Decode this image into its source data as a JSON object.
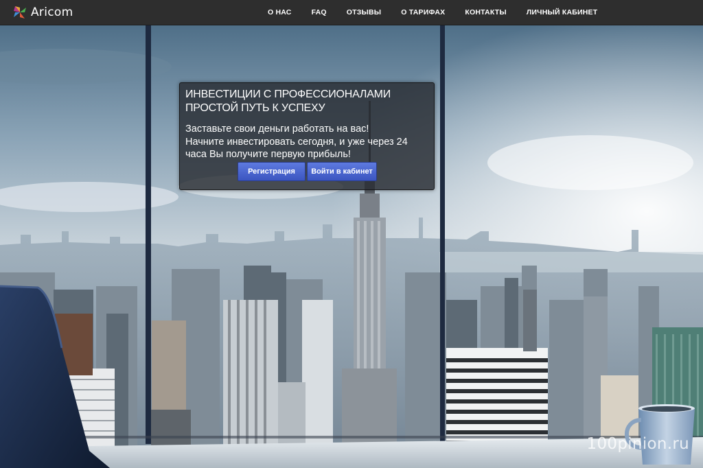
{
  "brand": {
    "name": "Aricom"
  },
  "nav": [
    {
      "label": "О НАС"
    },
    {
      "label": "FAQ"
    },
    {
      "label": "ОТЗЫВЫ"
    },
    {
      "label": "О ТАРИФАХ"
    },
    {
      "label": "КОНТАКТЫ"
    },
    {
      "label": "ЛИЧНЫЙ КАБИНЕТ"
    }
  ],
  "hero": {
    "title_line1": "ИНВЕСТИЦИИ С ПРОФЕССИОНАЛАМИ",
    "title_line2": "ПРОСТОЙ ПУТЬ К УСПЕХУ",
    "text_line1": "Заставьте свои деньги работать на вас!",
    "text_line2": "Начните инвестировать сегодня, и уже через 24",
    "text_line3": "часа Вы получите первую прибыль!",
    "register_label": "Регистрация",
    "login_label": "Войти в кабинет"
  },
  "watermark": "100pinion.ru",
  "colors": {
    "topbar": "#2e2e2e",
    "button_top": "#5e7ae0",
    "button_bottom": "#3b55c0",
    "panel_bg": "#282c32"
  }
}
